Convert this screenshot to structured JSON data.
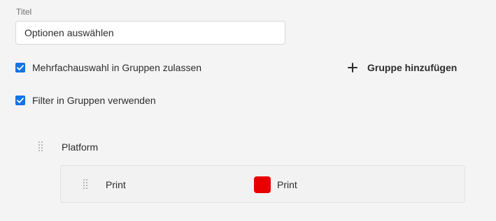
{
  "title_field": {
    "label": "Titel",
    "value": "Optionen auswählen"
  },
  "options": {
    "multi_select": {
      "label": "Mehrfachauswahl in Gruppen zulassen",
      "checked": true
    },
    "use_filter": {
      "label": "Filter in Gruppen verwenden",
      "checked": true
    }
  },
  "add_group_button": {
    "label": "Gruppe hinzufügen",
    "icon": "plus-icon"
  },
  "group": {
    "name": "Platform",
    "items": [
      {
        "label": "Print",
        "color_label": "Print",
        "color": "#e80000"
      }
    ]
  },
  "colors": {
    "accent": "#1473e6",
    "background": "#f4f4f4",
    "swatch": "#e80000"
  }
}
